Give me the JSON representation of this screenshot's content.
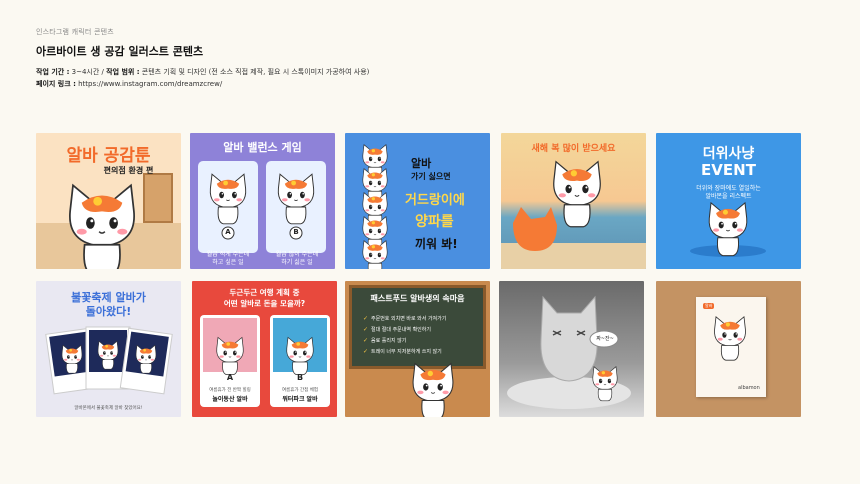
{
  "header": {
    "eyebrow": "인스타그램 캐릭터 콘텐츠",
    "title": "아르바이트 생 공감 일러스트 콘텐츠",
    "period_label": "작업 기간 :",
    "period_value": " 3~4시간 / ",
    "scope_label": "작업 범위 :",
    "scope_value": " 콘텐츠 기획 및 디자인 (전 소스 직접 제작, 필요 시 스톡이미지 가공하여 사용)",
    "link_label": "페이지 링크 :",
    "link_value": " https://www.instagram.com/dreamzcrew/"
  },
  "cards": {
    "c1": {
      "title": "알바 공감툰",
      "subtitle": "편의점 환경 편"
    },
    "c2": {
      "title": "알바 밸런스 게임",
      "opt_a": "A",
      "opt_b": "B",
      "a_text": "월급 적게 주는데\n하고 싶은 일",
      "b_text": "월급 많이 주는데\n하기 싫은 일"
    },
    "c3": {
      "title_1": "알바",
      "title_2": "가기 싫으면",
      "title_3": "거드랑이에",
      "title_4": "양파를",
      "title_5": "끼워 봐!"
    },
    "c4": {
      "title": "새해 복 많이 받으세요"
    },
    "c5": {
      "title_1": "더위사냥",
      "title_2": "EVENT",
      "sub_1": "더위와 장마에도 열일하는",
      "sub_2": "알바몬을 리스펙트"
    },
    "c6": {
      "title_1": "불꽃축제 알바가",
      "title_2": "돌아왔다!",
      "footer": "알바몬에서 불꽃축제 알바 찾았어요!"
    },
    "c7": {
      "title_1": "두근두근 여행 계획 중",
      "title_2": "어떤 알바로 돈을 모을까?",
      "opt_a": "A",
      "opt_b": "B",
      "a_small": "여름휴가 전 반짝 힐링",
      "a_big": "놀이동산 알바",
      "b_small": "여름휴가 간접 체험",
      "b_big": "워터파크 알바"
    },
    "c8": {
      "title": "패스트푸드 알바생의 속마음",
      "line_1": "주문번호 외치면 바로 와서 가져가기",
      "line_2": "절대 절대 주문내역 확인하기",
      "line_3": "음료 흘리지 않기",
      "line_4": "트레이 너무 지저분하게 쓰지 않기"
    },
    "c9": {
      "bubble": "짜~잔~"
    },
    "c10": {
      "tag": "알바",
      "brand": "albamon"
    }
  },
  "colors": {
    "orange": "#f26a2a",
    "cream": "#fbf9f2",
    "blue": "#4a8fe0",
    "purple": "#7b6fd1",
    "chalk_green": "#3b4a3a"
  }
}
